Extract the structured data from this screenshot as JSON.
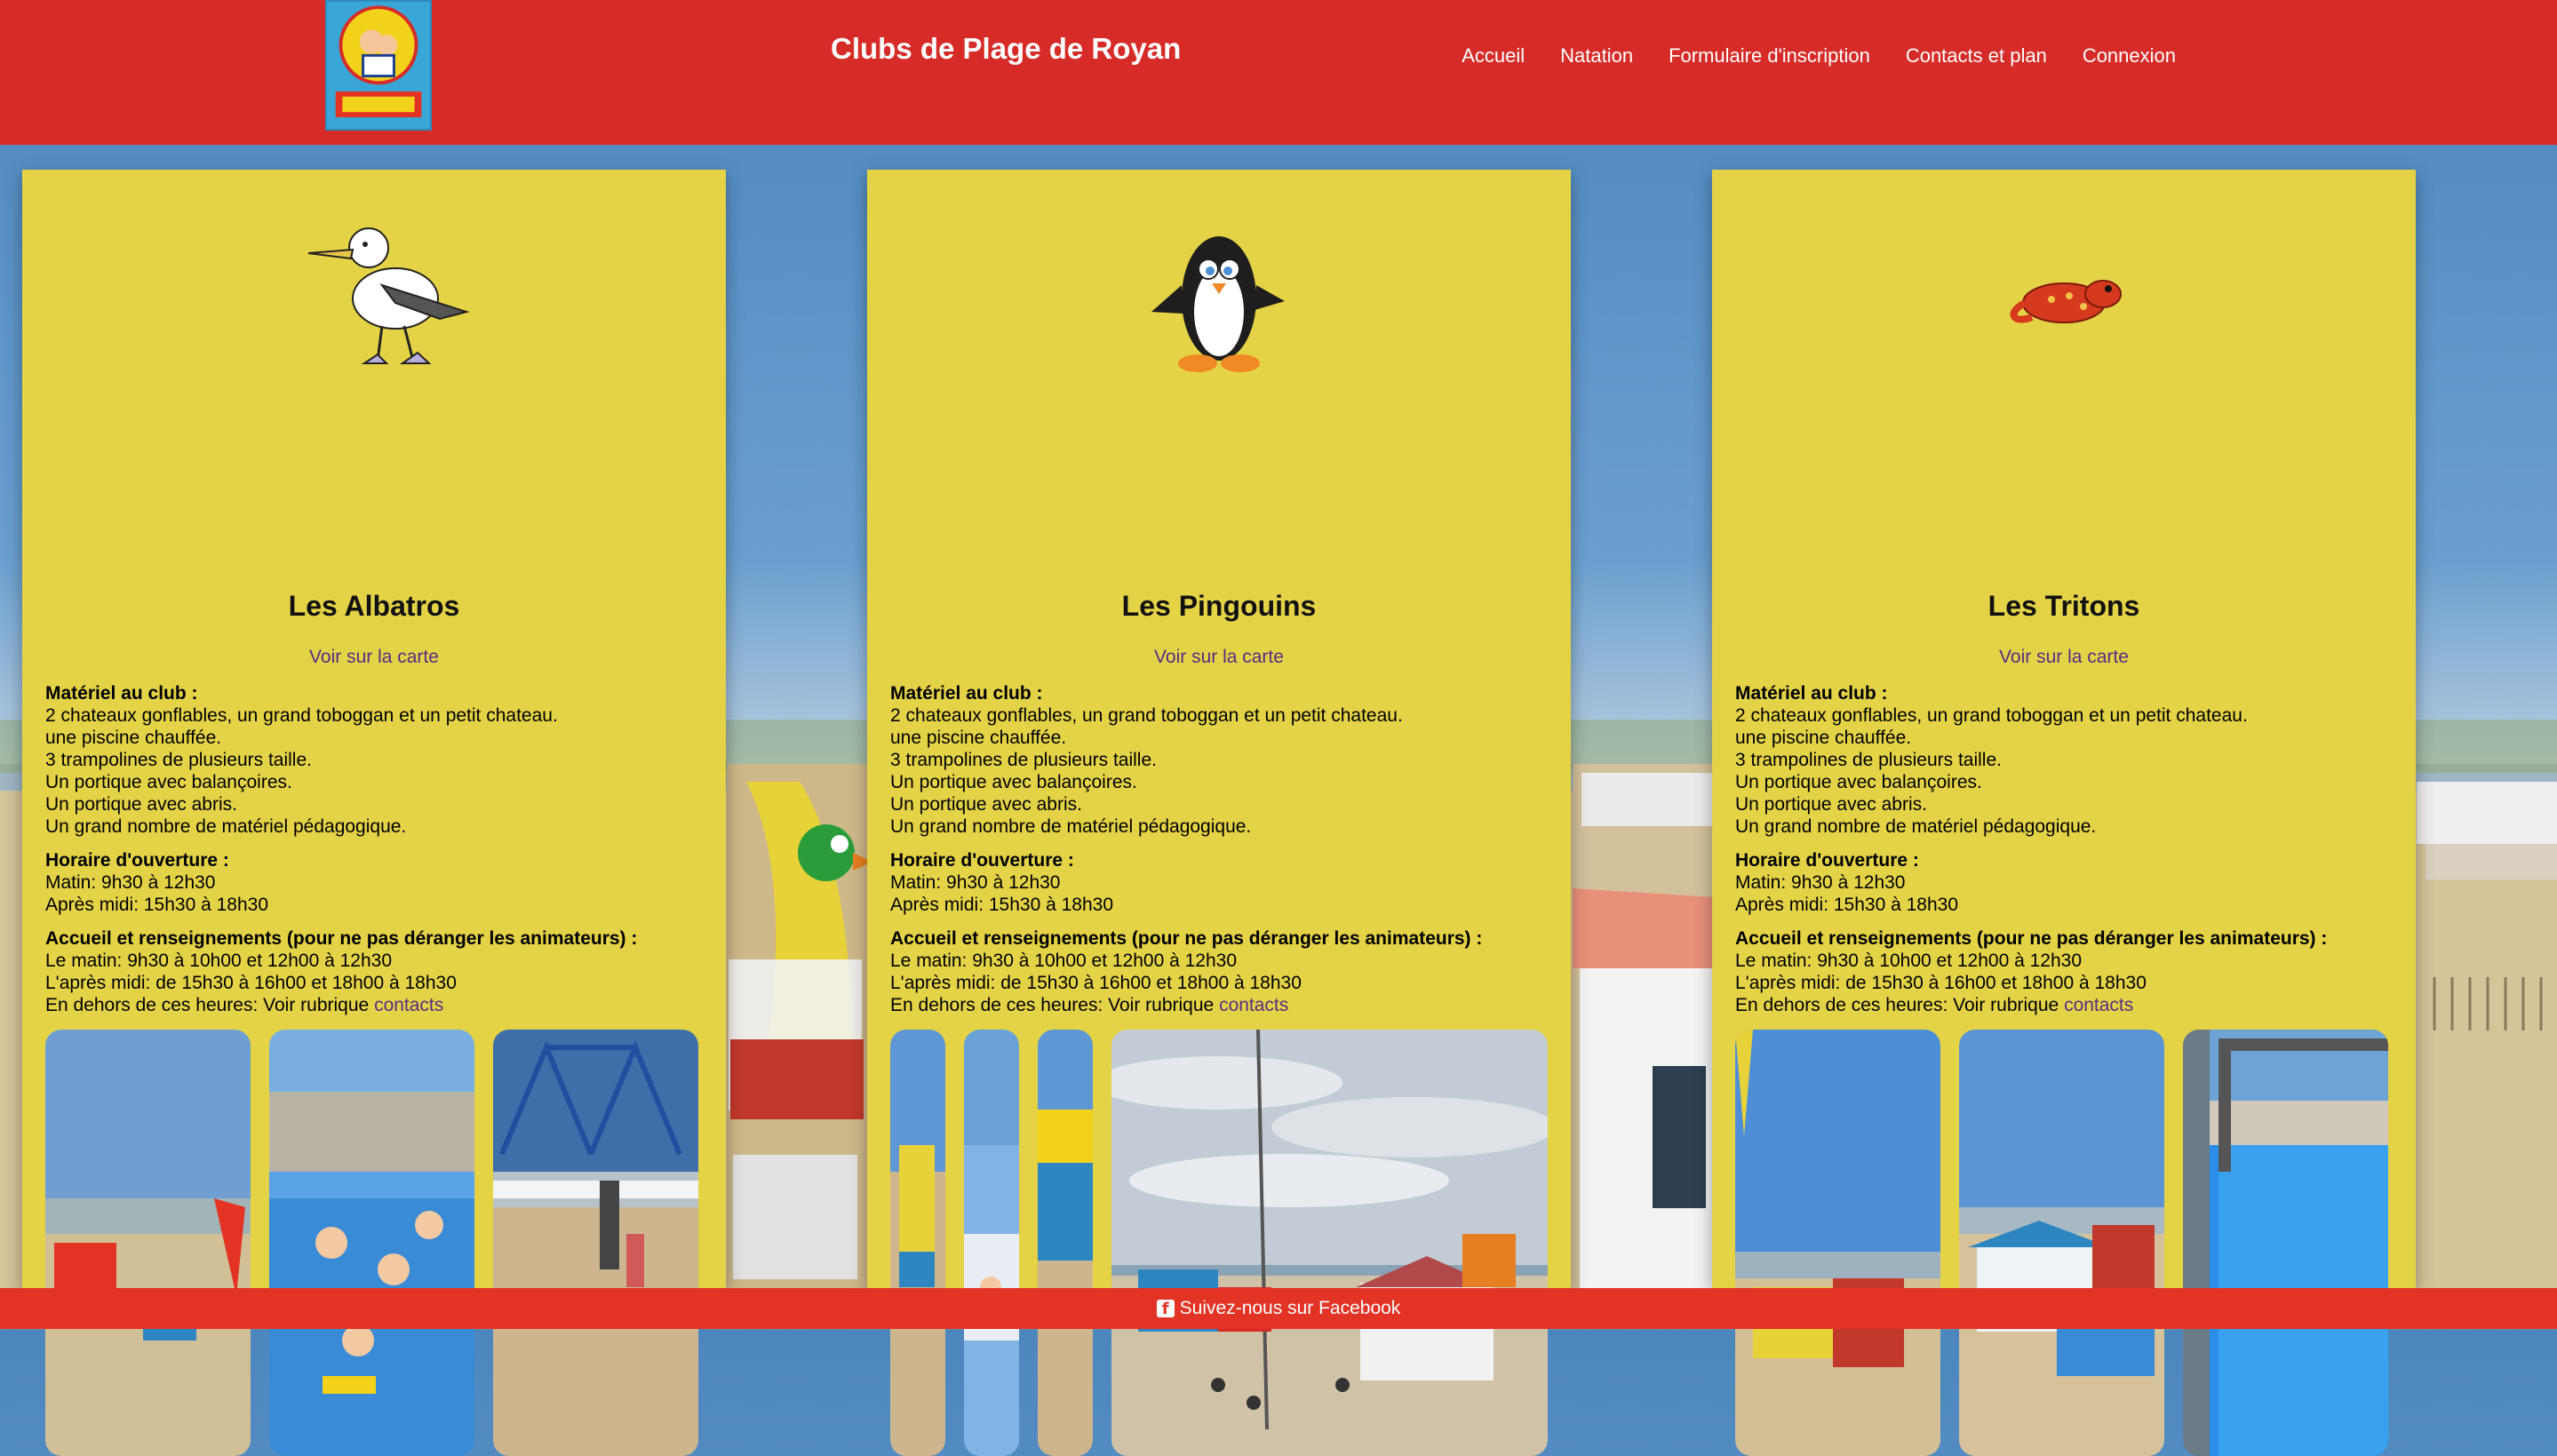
{
  "header": {
    "logo_name": "clubs-de-plage-mickey-logo",
    "title": "Clubs de Plage de Royan",
    "nav": [
      {
        "label": "Accueil"
      },
      {
        "label": "Natation"
      },
      {
        "label": "Formulaire d'inscription"
      },
      {
        "label": "Contacts et plan"
      },
      {
        "label": "Connexion"
      }
    ]
  },
  "clubs": [
    {
      "name": "Les Albatros",
      "mascot": "albatross",
      "map_link": "Voir sur la carte",
      "equipment_title": "Matériel au club :",
      "equipment": [
        "2 chateaux gonflables, un grand toboggan et un petit chateau.",
        "une piscine chauffée.",
        "3 trampolines de plusieurs taille.",
        "Un portique avec balançoires.",
        "Un portique avec abris.",
        "Un grand nombre de matériel pédagogique."
      ],
      "hours_title": "Horaire d'ouverture :",
      "hours": [
        "Matin: 9h30 à 12h30",
        "Après midi: 15h30 à 18h30"
      ],
      "reception_title": "Accueil et renseignements (pour ne pas déranger les animateurs) :",
      "reception": [
        "Le matin: 9h30 à 10h00 et 12h00 à 12h30",
        "L'après midi: de 15h30 à 16h00 et 18h00 à 18h30"
      ],
      "outside_hours": "En dehors de ces heures: Voir rubrique ",
      "contacts_link": "contacts"
    },
    {
      "name": "Les Pingouins",
      "mascot": "penguin",
      "map_link": "Voir sur la carte",
      "equipment_title": "Matériel au club :",
      "equipment": [
        "2 chateaux gonflables, un grand toboggan et un petit chateau.",
        "une piscine chauffée.",
        "3 trampolines de plusieurs taille.",
        "Un portique avec balançoires.",
        "Un portique avec abris.",
        "Un grand nombre de matériel pédagogique."
      ],
      "hours_title": "Horaire d'ouverture :",
      "hours": [
        "Matin: 9h30 à 12h30",
        "Après midi: 15h30 à 18h30"
      ],
      "reception_title": "Accueil et renseignements (pour ne pas déranger les animateurs) :",
      "reception": [
        "Le matin: 9h30 à 10h00 et 12h00 à 12h30",
        "L'après midi: de 15h30 à 16h00 et 18h00 à 18h30"
      ],
      "outside_hours": "En dehors de ces heures: Voir rubrique ",
      "contacts_link": "contacts"
    },
    {
      "name": "Les Tritons",
      "mascot": "newt",
      "map_link": "Voir sur la carte",
      "equipment_title": "Matériel au club :",
      "equipment": [
        "2 chateaux gonflables, un grand toboggan et un petit chateau.",
        "une piscine chauffée.",
        "3 trampolines de plusieurs taille.",
        "Un portique avec balançoires.",
        "Un portique avec abris.",
        "Un grand nombre de matériel pédagogique."
      ],
      "hours_title": "Horaire d'ouverture :",
      "hours": [
        "Matin: 9h30 à 12h30",
        "Après midi: 15h30 à 18h30"
      ],
      "reception_title": "Accueil et renseignements (pour ne pas déranger les animateurs) :",
      "reception": [
        "Le matin: 9h30 à 10h00 et 12h00 à 12h30",
        "L'après midi: de 15h30 à 16h00 et 18h00 à 18h30"
      ],
      "outside_hours": "En dehors de ces heures: Voir rubrique ",
      "contacts_link": "contacts"
    }
  ],
  "footer": {
    "icon": "facebook-icon",
    "label": "Suivez-nous sur Facebook"
  },
  "colors": {
    "header_red": "#d72b27",
    "card_yellow": "#e4d346",
    "link_purple": "#5b2a86",
    "footer_red": "#e23325"
  }
}
